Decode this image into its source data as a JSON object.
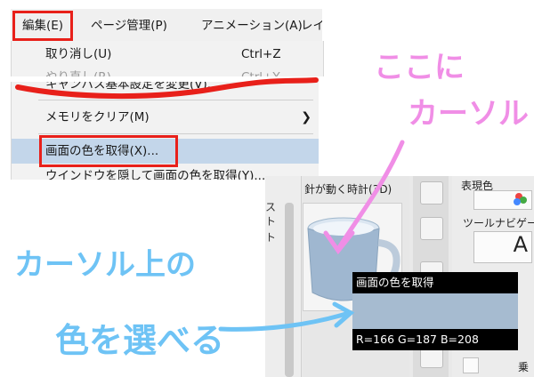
{
  "menubar": {
    "edit": "編集(E)",
    "page": "ページ管理(P)",
    "anim": "アニメーション(A)",
    "layer": "レイヤ"
  },
  "dropdown": {
    "undo": {
      "label": "取り消し(U)",
      "shortcut": "Ctrl+Z"
    },
    "redo": {
      "label": "やり直し(R)",
      "shortcut": "Ctrl+Y"
    },
    "canvas_settings": "キャンバス基本設定を変更(V)...",
    "clear_memory": "メモリをクリア(M)",
    "get_screen_color": "画面の色を取得(X)...",
    "hide_window_get_color": "ウインドウを隠して画面の色を取得(Y)..."
  },
  "app": {
    "canvas_caption": "針が動く時計(3D)",
    "left_chars": [
      "ス",
      "ト",
      "ト"
    ],
    "right_top_label": "表現色",
    "tool_navi_label": "ツールナビゲー",
    "letter_a": "A",
    "bottom_right_label": "乗"
  },
  "tooltip": {
    "title": "画面の色を取得",
    "rgb": "R=166 G=187 B=208",
    "swatch_color": "#a6bbd0"
  },
  "annotations": {
    "here_line1": "ここに",
    "here_line2": "カーソル",
    "on_cursor": "カーソル上の",
    "pick_color": "色を選べる"
  },
  "colors": {
    "red": "#e8201a",
    "pink": "#f08ee6",
    "blue": "#6ec3f5",
    "highlight": "#c3d6ea"
  }
}
